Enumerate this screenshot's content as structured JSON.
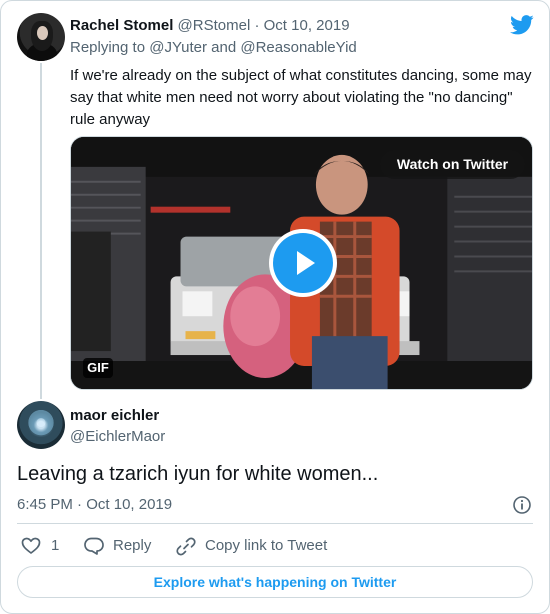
{
  "parent_tweet": {
    "author_name": "Rachel Stomel",
    "author_handle": "@RStomel",
    "separator": "·",
    "date": "Oct 10, 2019",
    "replying_prefix": "Replying to",
    "replying_to_1": "@JYuter",
    "replying_and": "and",
    "replying_to_2": "@ReasonableYid",
    "text": "If we're already on the subject of what constitutes dancing, some may say that white men need not worry about violating the \"no dancing\" rule anyway"
  },
  "media": {
    "watch_label": "Watch on Twitter",
    "badge": "GIF",
    "play_icon": "play-icon"
  },
  "tweet": {
    "author_name": "maor eichler",
    "author_handle": "@EichlerMaor",
    "text": "Leaving a tzarich iyun for white women...",
    "time": "6:45 PM",
    "separator": "·",
    "date": "Oct 10, 2019"
  },
  "actions": {
    "like_count": "1",
    "reply_label": "Reply",
    "copy_label": "Copy link to Tweet"
  },
  "footer": {
    "explore_label": "Explore what's happening on Twitter"
  },
  "colors": {
    "accent": "#1d9bf0",
    "secondary_text": "#536471",
    "border": "#cfd9de"
  },
  "icons": [
    "twitter-bird-icon",
    "play-icon",
    "info-icon",
    "heart-icon",
    "reply-icon",
    "link-icon"
  ]
}
